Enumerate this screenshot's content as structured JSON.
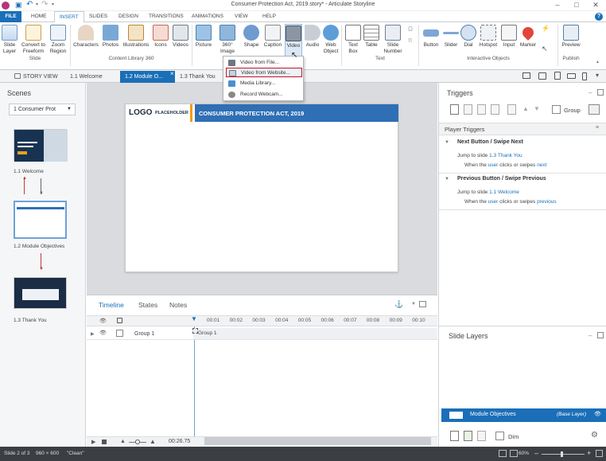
{
  "titlebar": {
    "title": "Consumer Protection Act, 2019.story* - Articulate Storyline",
    "help": "?"
  },
  "ribbon_tabs": [
    "FILE",
    "HOME",
    "INSERT",
    "SLIDES",
    "DESIGN",
    "TRANSITIONS",
    "ANIMATIONS",
    "VIEW",
    "HELP"
  ],
  "ribbon": {
    "slide_layer": "Slide Layer",
    "convert": "Convert to Freeform",
    "zoom_region": "Zoom Region",
    "group_slide": "Slide",
    "characters": "Characters",
    "photos": "Photos",
    "illustrations": "Illustrations",
    "icons": "Icons",
    "videos": "Videos",
    "group_content": "Content Library 360",
    "picture": "Picture",
    "image360": "360° Image",
    "shape": "Shape",
    "caption": "Caption",
    "video": "Video",
    "audio": "Audio",
    "web_object": "Web Object",
    "text_box": "Text Box",
    "table": "Table",
    "slide_number": "Slide Number",
    "group_text": "Text",
    "button": "Button",
    "slider": "Slider",
    "dial": "Dial",
    "hotspot": "Hotspot",
    "input": "Input",
    "marker": "Marker",
    "group_interactive": "Interactive Objects",
    "preview": "Preview",
    "group_publish": "Publish"
  },
  "video_menu": [
    "Video from File...",
    "Video from Website...",
    "Media Library...",
    "Record Webcam..."
  ],
  "view_tabs": {
    "story_view": "STORY VIEW",
    "tab1": "1.1 Welcome",
    "tab2": "1.2 Module O...",
    "tab3": "1.3 Thank You",
    "close": "×"
  },
  "scenes": {
    "title": "Scenes",
    "dropdown": "1 Consumer Prot",
    "slides": [
      "1.1 Welcome",
      "1.2 Module Objectives",
      "1.3 Thank You"
    ]
  },
  "slide": {
    "logo": "LOGO",
    "logo_sub": "PLACEHOLDER",
    "header": "CONSUMER PROTECTION ACT, 2019"
  },
  "timeline": {
    "tabs": [
      "Timeline",
      "States",
      "Notes"
    ],
    "ticks": [
      "00:01",
      "00:02",
      "00:03",
      "00:04",
      "00:05",
      "00:06",
      "00:07",
      "00:08",
      "00:09",
      "00:10"
    ],
    "row_name": "Group 1",
    "bar_name": "Group 1",
    "time": "00:26.75"
  },
  "triggers": {
    "title": "Triggers",
    "group_label": "Group",
    "player_triggers": "Player Triggers",
    "next_title": "Next Button / Swipe Next",
    "next_action_prefix": "Jump to slide ",
    "next_target": "1.3 Thank You",
    "next_when_a": "When the ",
    "next_user": "user",
    "next_when_b": " clicks or swipes ",
    "next_dir": "next",
    "prev_title": "Previous Button / Swipe Previous",
    "prev_action_prefix": "Jump to slide ",
    "prev_target": "1.1 Welcome",
    "prev_when_a": "When the ",
    "prev_user": "user",
    "prev_when_b": " clicks or swipes ",
    "prev_dir": "previous"
  },
  "layers": {
    "title": "Slide Layers",
    "base_name": "Module Objectives",
    "base_tag": "(Base Layer)",
    "dim": "Dim"
  },
  "status": {
    "slide": "Slide 2 of 3",
    "size": "960 × 600",
    "theme": "\"Clean\"",
    "zoom": "60%"
  },
  "colors": {
    "accent": "#1a6fb8",
    "highlight": "#c0152b",
    "slide_header": "#2f6fb5",
    "logo_bar": "#f39c12"
  }
}
